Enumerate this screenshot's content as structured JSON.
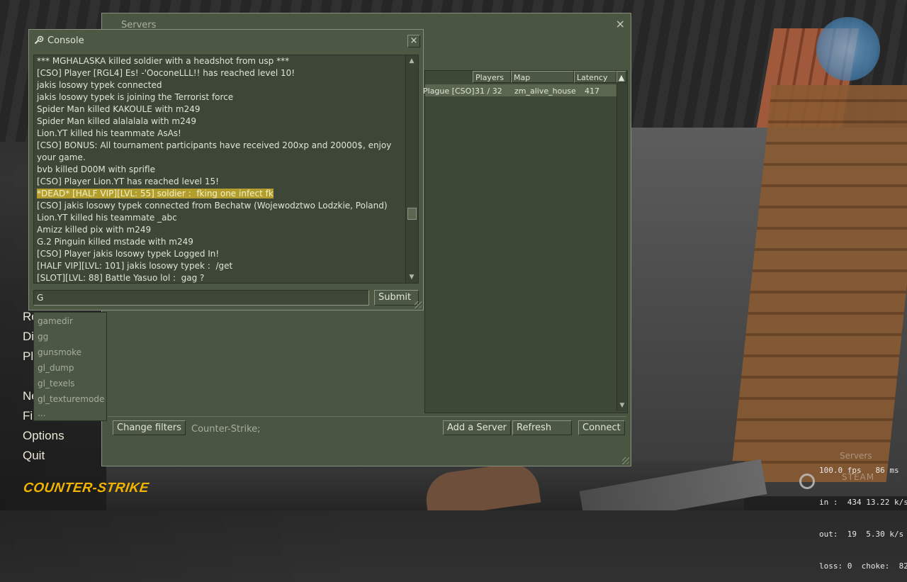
{
  "menu": {
    "items": [
      "Re",
      "Di",
      "Pl",
      "Ne",
      "Fi",
      "Options",
      "Quit"
    ],
    "logo": "COUNTER-STRIKE"
  },
  "servers": {
    "title": "Servers",
    "close_glyph": "×",
    "columns": [
      "Players",
      "Map",
      "Latency"
    ],
    "row": {
      "name": "Plague [CSO]",
      "players": "31 / 32",
      "map": "zm_alive_house",
      "latency": "417"
    },
    "filter_text": "Counter-Strike;",
    "buttons": {
      "change_filters": "Change filters",
      "add_server": "Add a Server",
      "refresh": "Refresh",
      "connect": "Connect"
    }
  },
  "console": {
    "title": "Console",
    "close_glyph": "×",
    "lines": [
      "*** MGHALASKA killed soldier with a headshot from usp ***",
      "[CSO] Player [RGL4] Es! -'OoconeLLL!! has reached level 10!",
      "jakis losowy typek connected",
      "jakis losowy typek is joining the Terrorist force",
      "Spider Man killed KAKOULE with m249",
      "Spider Man killed alalalala with m249",
      "Lion.YT killed his teammate AsAs!",
      "[CSO] BONUS: All tournament participants have received 200xp and 20000$, enjoy your game.",
      "bvb killed D00M with sprifle",
      "[CSO] Player Lion.YT has reached level 15!",
      "*DEAD* [HALF VIP][LVL: 55] soldier :  fking one infect fk",
      "[CSO] jakis losowy typek connected from Bechatw (Wojewodztwo Lodzkie, Poland)",
      "Lion.YT killed his teammate _abc",
      "Amizz killed pix with m249",
      "G.2 Pinguin killed mstade with m249",
      "[CSO] Player jakis losowy typek Logged In!",
      "[HALF VIP][LVL: 101] jakis losowy typek :  /get",
      "[SLOT][LVL: 88] Battle Yasuo lol :  gag ?"
    ],
    "highlighted_line_index": 10,
    "input_value": "G",
    "submit_label": "Submit",
    "autocomplete": [
      "gamedir",
      "gg",
      "gunsmoke",
      "gl_dump",
      "gl_texels",
      "gl_texturemode",
      "..."
    ]
  },
  "netgraph": {
    "line1": "100.0 fps   86 ms",
    "line2": "in :  434 13.22 k/s",
    "line3": "out:  19  5.30 k/s",
    "line4": "loss: 0  choke:  82",
    "overlay_servers": "Servers",
    "overlay_steam": "STEAM"
  },
  "colors": {
    "panel": "#4c5844",
    "highlight": "#b39e2d",
    "logo": "#f0b400"
  }
}
